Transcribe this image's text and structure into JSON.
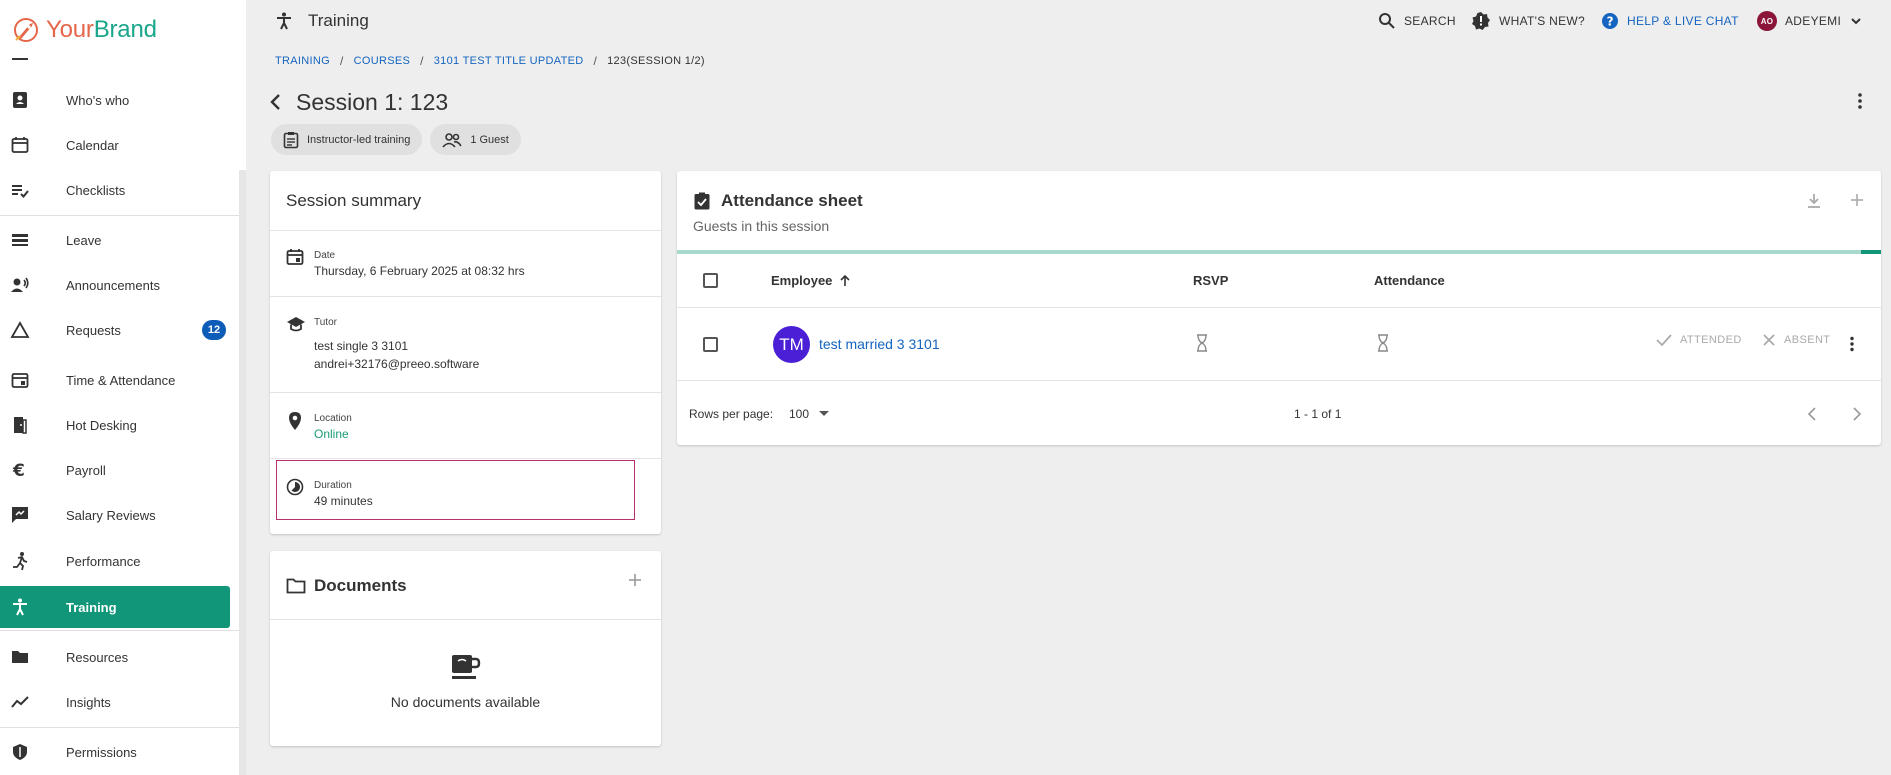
{
  "brand": {
    "prefix": "Your",
    "name": "Brand"
  },
  "sidebar": {
    "items": [
      {
        "label": "Who's who"
      },
      {
        "label": "Calendar"
      },
      {
        "label": "Checklists"
      },
      {
        "label": "Leave"
      },
      {
        "label": "Announcements"
      },
      {
        "label": "Requests",
        "badge": "12"
      },
      {
        "label": "Time & Attendance"
      },
      {
        "label": "Hot Desking"
      },
      {
        "label": "Payroll"
      },
      {
        "label": "Salary Reviews"
      },
      {
        "label": "Performance"
      },
      {
        "label": "Training",
        "active": true
      },
      {
        "label": "Resources"
      },
      {
        "label": "Insights"
      },
      {
        "label": "Permissions"
      }
    ]
  },
  "topbar": {
    "title": "Training",
    "search": "SEARCH",
    "whats_new": "WHAT'S NEW?",
    "help": "HELP & LIVE CHAT",
    "user_initials": "AO",
    "user_name": "ADEYEMI"
  },
  "breadcrumb": [
    "TRAINING",
    "COURSES",
    "3101 TEST TITLE UPDATED",
    "123(SESSION 1/2)"
  ],
  "page": {
    "title": "Session 1: 123",
    "chips": [
      "Instructor-led training",
      "1 Guest"
    ]
  },
  "summary": {
    "title": "Session summary",
    "date_label": "Date",
    "date_value": "Thursday, 6 February 2025 at 08:32 hrs",
    "tutor_label": "Tutor",
    "tutor_name": "test single 3 3101",
    "tutor_email": "andrei+32176@preeo.software",
    "location_label": "Location",
    "location_value": "Online",
    "duration_label": "Duration",
    "duration_value": "49 minutes"
  },
  "documents": {
    "title": "Documents",
    "empty": "No documents available"
  },
  "attendance": {
    "title": "Attendance sheet",
    "subtitle": "Guests in this session",
    "columns": {
      "employee": "Employee",
      "rsvp": "RSVP",
      "attendance": "Attendance"
    },
    "rows": [
      {
        "initials": "TM",
        "name": "test married 3 3101",
        "attended": "ATTENDED",
        "absent": "ABSENT"
      }
    ],
    "rows_per_page_label": "Rows per page:",
    "rows_per_page": "100",
    "range": "1 - 1 of 1"
  },
  "colors": {
    "accent": "#12967a",
    "link": "#1565c0",
    "badge": "#0d5cb8"
  }
}
